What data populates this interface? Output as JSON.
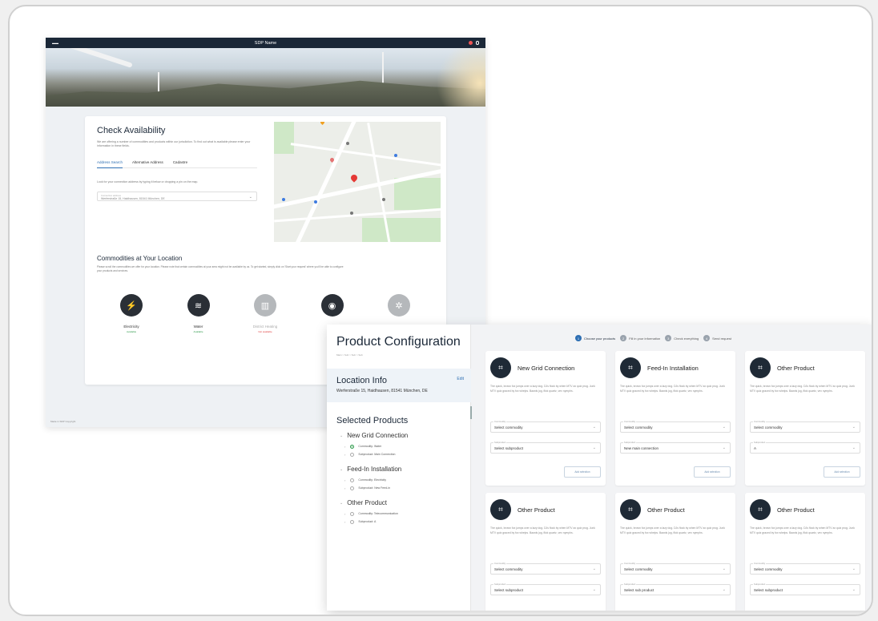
{
  "back_window": {
    "title": "SDP Name",
    "check": {
      "heading": "Check Availability",
      "description": "We are offering a number of commodities and products within our jurisdiction. To find out what is available please enter your information in these fields.",
      "tabs": [
        "Address Search",
        "Alternative Address",
        "Cadastre"
      ],
      "hint": "Look for your connection address by typing it below or dropping a pin on the map.",
      "address_label": "Connection address",
      "address_value": "Werferstraße 15, Haidhausen, 81541 München, DE"
    },
    "commodities": {
      "heading": "Commodities at Your Location",
      "description": "Please scroll the commodities we offer for your location. Please note that certain commodities at your area might not be available by us. To get started, simply click on 'Start your request' where you'll be able to configure your products and services.",
      "items": [
        {
          "name": "Electricity",
          "status": "Available",
          "available": true,
          "icon": "plug-icon"
        },
        {
          "name": "Water",
          "status": "Available",
          "available": true,
          "icon": "water-tap-icon"
        },
        {
          "name": "District Heating",
          "status": "Not available",
          "available": false,
          "icon": "radiator-icon"
        },
        {
          "name": "",
          "status": "",
          "available": true,
          "icon": "gas-drop-icon"
        },
        {
          "name": "",
          "status": "",
          "available": false,
          "icon": "antenna-icon"
        }
      ]
    },
    "footer": "Made in SDP Copyright"
  },
  "front_window": {
    "title": "Product Configuration",
    "breadcrumb": "Main > Sub > Sub > Sub",
    "location": {
      "heading": "Location Info",
      "edit": "Edit",
      "address": "Werferstraße 15, Haidhausen, 81541 München, DE"
    },
    "selected_heading": "Selected Products",
    "selected": [
      {
        "group": "New Grid Connection",
        "items": [
          {
            "label": "Commodity: Water",
            "checked": true
          },
          {
            "label": "Subproduct: Main Connection",
            "checked": false
          }
        ]
      },
      {
        "group": "Feed-In Installation",
        "items": [
          {
            "label": "Commodity: Electricity",
            "checked": false
          },
          {
            "label": "Subproduct: New Feed-in",
            "checked": false
          }
        ]
      },
      {
        "group": "Other Product",
        "items": [
          {
            "label": "Commodity: Telecommunication",
            "checked": false
          },
          {
            "label": "Subproduct: A",
            "checked": false
          }
        ]
      }
    ],
    "steps": [
      {
        "num": "1",
        "label": "Choose your products",
        "active": true
      },
      {
        "num": "2",
        "label": "Fill in your information",
        "active": false
      },
      {
        "num": "3",
        "label": "Check everything",
        "active": false
      },
      {
        "num": "4",
        "label": "Send request",
        "active": false
      }
    ],
    "card_description": "The quick, brown fox jumps over a lazy dog. DJs flock by when MTV ax quiz prog. Junk MTV quiz graced by fox whelps. Bawds jog, flick quartz, vex nymphs.",
    "commodity_label": "Commodity",
    "subproduct_label": "Subproduct",
    "add_button": "Add selection",
    "cards": [
      {
        "title": "New Grid Connection",
        "commodity": "Select commodity",
        "subproduct": "Select subproduct",
        "show_button": true
      },
      {
        "title": "Feed-In Installation",
        "commodity": "Select commodity",
        "subproduct": "New main connection",
        "show_button": true
      },
      {
        "title": "Other Product",
        "commodity": "Select commodity",
        "subproduct": "A",
        "show_button": true
      },
      {
        "title": "Other Product",
        "commodity": "Select commodity",
        "subproduct": "Select subproduct",
        "show_button": false
      },
      {
        "title": "Other Product",
        "commodity": "Select commodity",
        "subproduct": "Select sub product",
        "show_button": false
      },
      {
        "title": "Other Product",
        "commodity": "Select commodity",
        "subproduct": "Select subproduct",
        "show_button": false
      }
    ]
  }
}
